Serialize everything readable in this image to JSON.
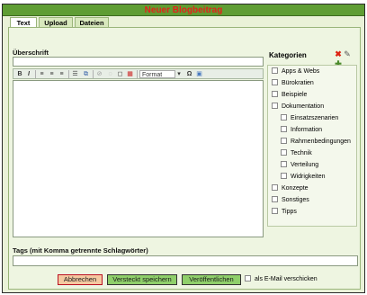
{
  "window": {
    "title": "Neuer Blogbeitrag"
  },
  "tabs": [
    {
      "label": "Text",
      "active": true
    },
    {
      "label": "Upload",
      "active": false
    },
    {
      "label": "Dateien",
      "active": false
    }
  ],
  "form": {
    "heading_label": "Überschrift",
    "heading_value": "",
    "tags_label": "Tags (mit Komma getrennte Schlagwörter)",
    "tags_value": ""
  },
  "toolbar": {
    "bold": "B",
    "italic": "I",
    "format_label": "Format",
    "omega": "Ω"
  },
  "categories": {
    "title": "Kategorien",
    "items": [
      {
        "label": "Apps & Webs",
        "level": 0,
        "checked": false
      },
      {
        "label": "Bürokratien",
        "level": 0,
        "checked": false
      },
      {
        "label": "Beispiele",
        "level": 0,
        "checked": false
      },
      {
        "label": "Dokumentation",
        "level": 0,
        "checked": false
      },
      {
        "label": "Einsatzszenarien",
        "level": 1,
        "checked": false
      },
      {
        "label": "Information",
        "level": 1,
        "checked": false
      },
      {
        "label": "Rahmenbedingungen",
        "level": 1,
        "checked": false
      },
      {
        "label": "Technik",
        "level": 1,
        "checked": false
      },
      {
        "label": "Verteilung",
        "level": 1,
        "checked": false
      },
      {
        "label": "Widrigkeiten",
        "level": 1,
        "checked": false
      },
      {
        "label": "Konzepte",
        "level": 0,
        "checked": false
      },
      {
        "label": "Sonstiges",
        "level": 0,
        "checked": false
      },
      {
        "label": "Tipps",
        "level": 0,
        "checked": false
      }
    ]
  },
  "buttons": {
    "cancel": "Abbrechen",
    "save_hidden": "Versteckt speichern",
    "publish": "Veröffentlichen"
  },
  "email": {
    "label": "als E-Mail verschicken",
    "checked": false
  },
  "colors": {
    "accent_green": "#5f9d34",
    "title_red": "#e2231a",
    "button_green": "#8fcf6a",
    "cancel_border": "#bb1122"
  },
  "icons": [
    "delete-icon",
    "edit-icon",
    "add-icon"
  ]
}
